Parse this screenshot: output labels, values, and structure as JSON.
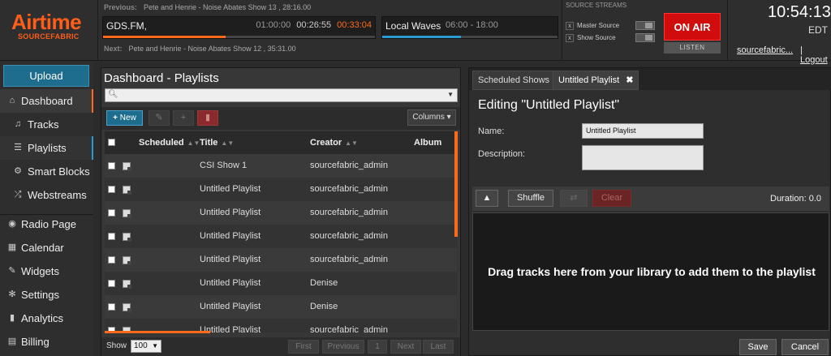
{
  "brand": {
    "name": "Airtime",
    "sub": "SOURCEFABRIC"
  },
  "header": {
    "previous_label": "Previous:",
    "previous_value": "Pete and Henrie - Noise Abates Show 13 , 28:16.00",
    "next_label": "Next:",
    "next_value": "Pete and Henrie - Noise Abates Show 12 , 35:31.00",
    "track": {
      "title": "GDS.FM,",
      "length": "01:00:00",
      "elapsed": "00:26:55",
      "remaining": "00:33:04",
      "progress": 0.45,
      "color": "#ff6a1a"
    },
    "show": {
      "title": "Local Waves",
      "time": "06:00 - 18:00",
      "progress": 0.45,
      "color": "#2a9bd0"
    },
    "source_streams": {
      "title": "SOURCE STREAMS",
      "master": "Master Source",
      "show": "Show Source",
      "mark": "x"
    },
    "on_air": "ON AIR",
    "listen": "LISTEN",
    "clock": "10:54:13",
    "timezone": "EDT",
    "user": "sourcefabric...",
    "logout_sep": "|",
    "logout": "Logout"
  },
  "sidebar": {
    "upload": "Upload",
    "items": [
      {
        "label": "Dashboard",
        "icon": "home-icon",
        "glyph": "⌂"
      },
      {
        "label": "Tracks",
        "icon": "music-icon",
        "glyph": "♫"
      },
      {
        "label": "Playlists",
        "icon": "list-icon",
        "glyph": "☰"
      },
      {
        "label": "Smart Blocks",
        "icon": "gear-icon",
        "glyph": "⚙"
      },
      {
        "label": "Webstreams",
        "icon": "shuffle-icon",
        "glyph": "⤮"
      },
      {
        "label": "Radio Page",
        "icon": "globe-icon",
        "glyph": "◉"
      },
      {
        "label": "Calendar",
        "icon": "calendar-icon",
        "glyph": "▦"
      },
      {
        "label": "Widgets",
        "icon": "wrench-icon",
        "glyph": "✎"
      },
      {
        "label": "Settings",
        "icon": "settings-icon",
        "glyph": "✻"
      },
      {
        "label": "Analytics",
        "icon": "chart-icon",
        "glyph": "▮"
      },
      {
        "label": "Billing",
        "icon": "billing-icon",
        "glyph": "▤"
      }
    ]
  },
  "library": {
    "title": "Dashboard - Playlists",
    "new_label": "New",
    "columns_label": "Columns",
    "headers": {
      "scheduled": "Scheduled",
      "title": "Title",
      "creator": "Creator",
      "album": "Album"
    },
    "rows": [
      {
        "title": "CSI Show 1",
        "creator": "sourcefabric_admin"
      },
      {
        "title": "Untitled Playlist",
        "creator": "sourcefabric_admin"
      },
      {
        "title": "Untitled Playlist",
        "creator": "sourcefabric_admin"
      },
      {
        "title": "Untitled Playlist",
        "creator": "sourcefabric_admin"
      },
      {
        "title": "Untitled Playlist",
        "creator": "sourcefabric_admin"
      },
      {
        "title": "Untitled Playlist",
        "creator": "Denise"
      },
      {
        "title": "Untitled Playlist",
        "creator": "Denise"
      },
      {
        "title": "Untitled Playlist",
        "creator": "sourcefabric_admin"
      }
    ],
    "show_label": "Show",
    "page_size": "100",
    "pager": {
      "first": "First",
      "previous": "Previous",
      "page": "1",
      "next": "Next",
      "last": "Last"
    }
  },
  "editor": {
    "tabs": {
      "scheduled": "Scheduled Shows",
      "playlist": "Untitled Playlist"
    },
    "heading": "Editing \"Untitled Playlist\"",
    "name_label": "Name:",
    "name_value": "Untitled Playlist",
    "description_label": "Description:",
    "description_value": "",
    "shuffle": "Shuffle",
    "clear": "Clear",
    "duration_label": "Duration:",
    "duration_value": "0.0",
    "drop_message": "Drag tracks here from your library to add them to the playlist",
    "save": "Save",
    "cancel": "Cancel"
  }
}
